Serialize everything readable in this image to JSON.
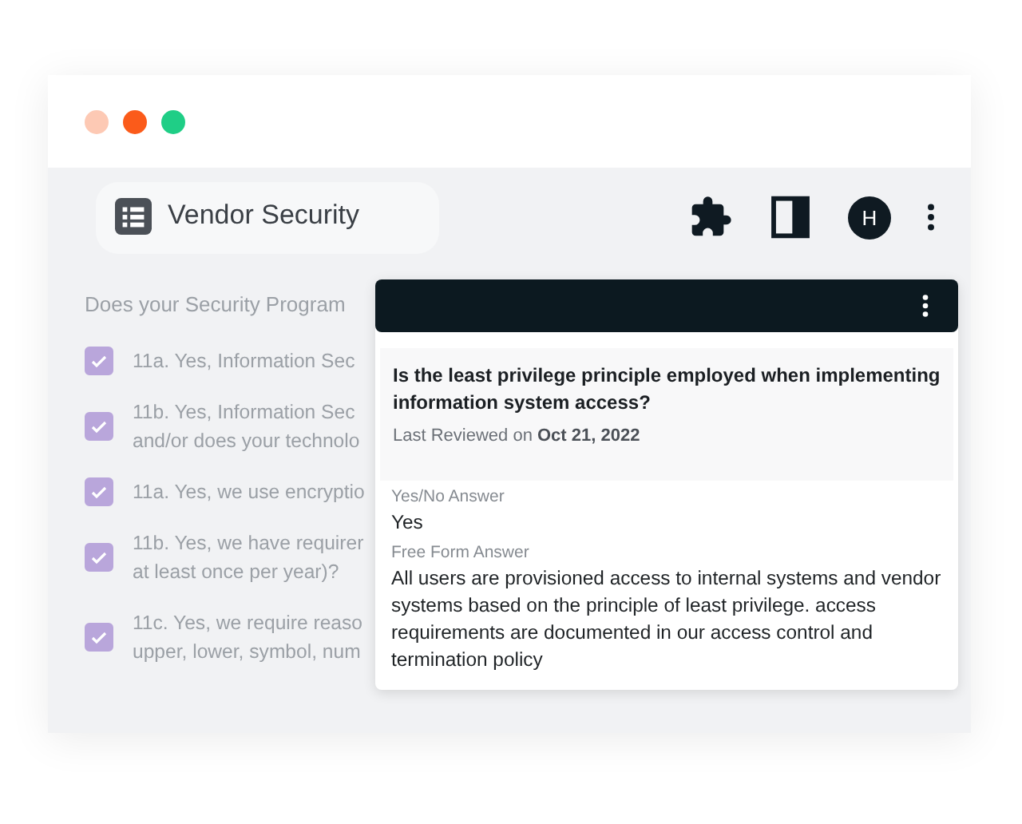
{
  "window": {
    "controls": [
      {
        "color": "#fdc9b4"
      },
      {
        "color": "#fb5b1a"
      },
      {
        "color": "#1fce86"
      }
    ]
  },
  "tab": {
    "title": "Vendor Security"
  },
  "toolbar": {
    "avatar": "H"
  },
  "question_list": {
    "heading": "Does your Security Program",
    "items": [
      {
        "lines": [
          "11a. Yes, Information Sec"
        ],
        "checked": true
      },
      {
        "lines": [
          "11b. Yes, Information Sec",
          "and/or does your technolo"
        ],
        "checked": true
      },
      {
        "lines": [
          "11a. Yes, we use encryptio"
        ],
        "checked": true
      },
      {
        "lines": [
          "11b. Yes, we have requirer",
          "at least once per year)?"
        ],
        "checked": true
      },
      {
        "lines": [
          "11c. Yes, we require reaso",
          "upper, lower, symbol, num"
        ],
        "checked": true
      }
    ]
  },
  "popup": {
    "question": "Is the least privilege principle employed when implementing information system access?",
    "reviewed": "Last Reviewed on **Oct 21, 2022**",
    "fields": [
      {
        "label": "Yes/No Answer",
        "value": "Yes"
      },
      {
        "label": "Free Form Answer",
        "value": "All users are provisioned access to internal systems and vendor systems based on the principle of least privilege. access requirements are documented in our access control and termination policy"
      }
    ]
  }
}
